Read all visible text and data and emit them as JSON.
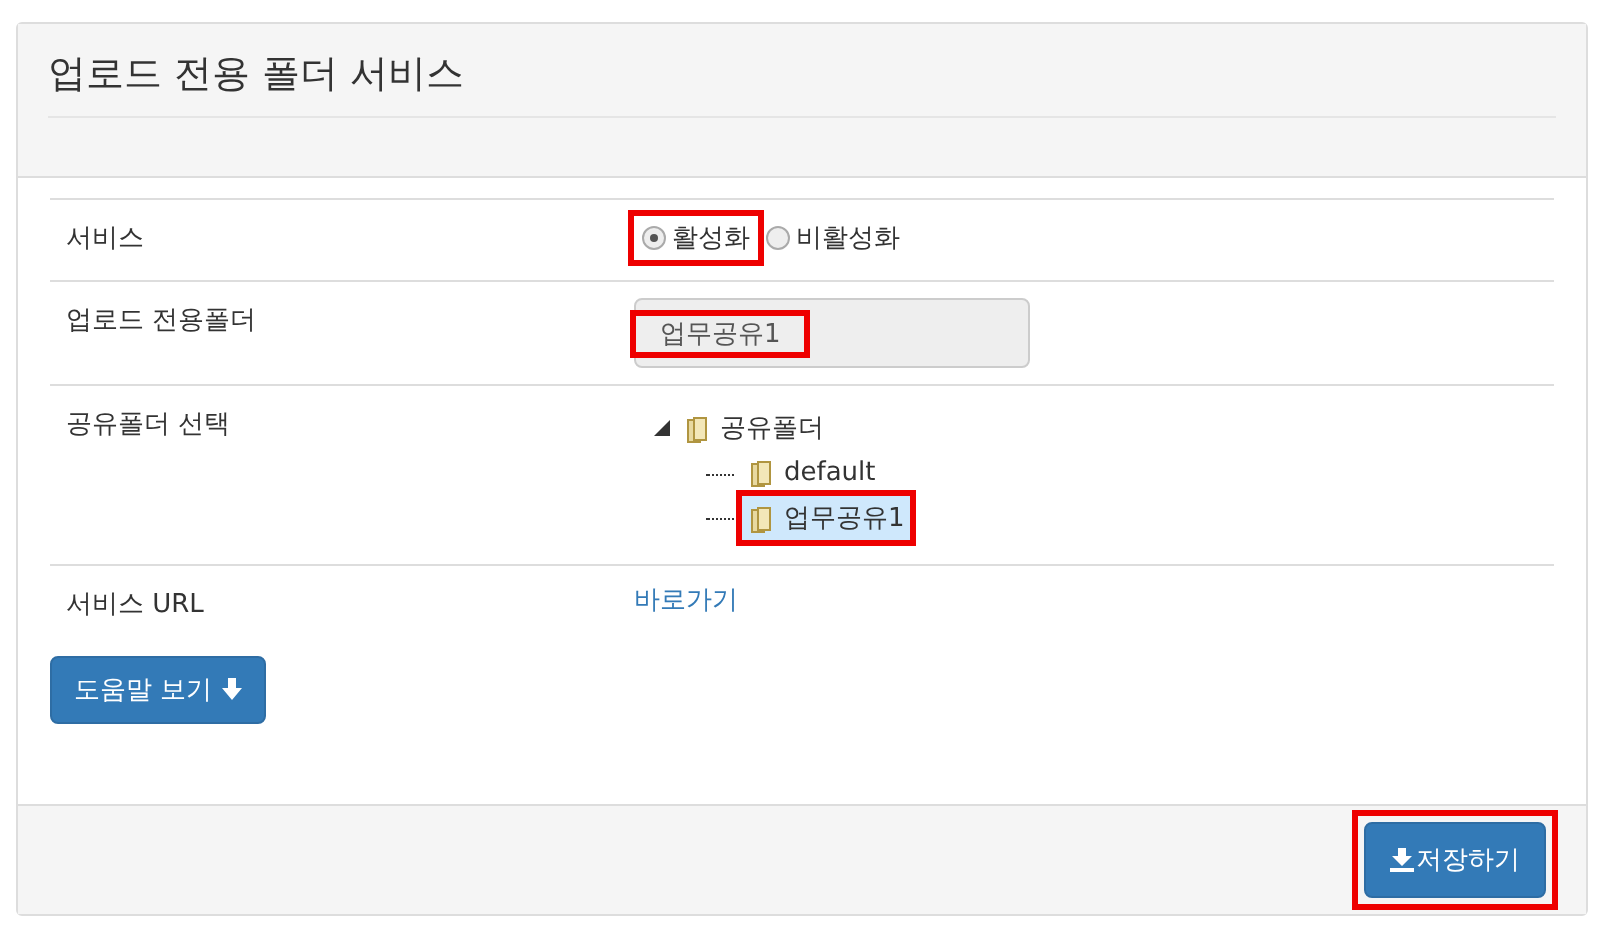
{
  "panel": {
    "title": "업로드 전용 폴더 서비스"
  },
  "rows": [
    {
      "kind": "radio",
      "label": "서비스",
      "options": [
        {
          "label": "활성화",
          "selected": true,
          "highlighted": true
        },
        {
          "label": "비활성화",
          "selected": false,
          "highlighted": false
        }
      ]
    },
    {
      "kind": "field",
      "label": "업로드 전용폴더",
      "value": "업무공유1",
      "highlighted": true
    },
    {
      "kind": "tree",
      "label": "공유폴더 선택",
      "tree": [
        {
          "label": "공유폴더",
          "expanded": true,
          "selected": false,
          "highlighted": false,
          "children": [
            {
              "label": "default",
              "selected": false,
              "highlighted": false
            },
            {
              "label": "업무공유1",
              "selected": true,
              "highlighted": true
            }
          ]
        }
      ]
    },
    {
      "kind": "link",
      "label": "서비스 URL",
      "link": "바로가기"
    }
  ],
  "help_button": {
    "label": "도움말 보기"
  },
  "save_button": {
    "label": "저장하기",
    "highlighted": true
  }
}
